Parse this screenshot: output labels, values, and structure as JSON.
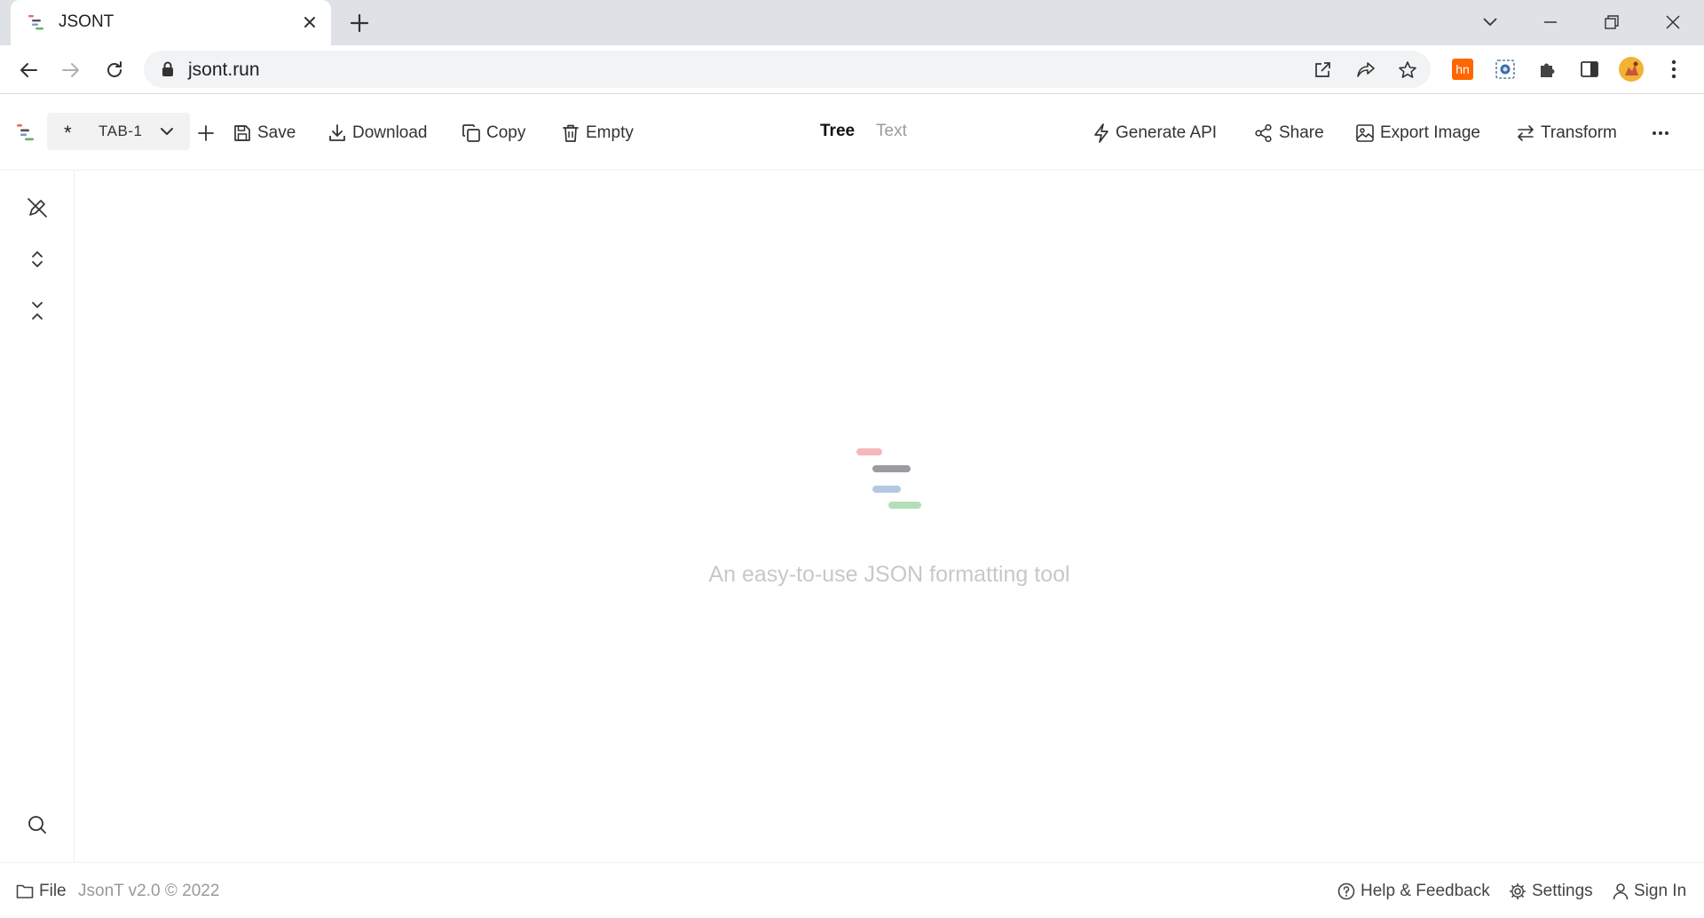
{
  "browser": {
    "tab_title": "JSONT",
    "url": "jsont.run",
    "extensions": [
      "hn-extension-icon",
      "screenshot-extension-icon",
      "puzzle-icon",
      "sidepanel-icon",
      "profile-avatar"
    ]
  },
  "header": {
    "tab_selector": {
      "marker": "*",
      "label": "TAB-1"
    },
    "actions": {
      "save": "Save",
      "download": "Download",
      "copy": "Copy",
      "empty": "Empty"
    },
    "modes": {
      "tree": "Tree",
      "text": "Text",
      "active": "Tree"
    },
    "right_actions": {
      "generate_api": "Generate API",
      "share": "Share",
      "export_image": "Export Image",
      "transform": "Transform"
    }
  },
  "empty_state": {
    "tagline": "An easy-to-use JSON formatting tool",
    "logo_colors": [
      "#f4b8bb",
      "#9a9ca0",
      "#b5c8e3",
      "#b3dfb8"
    ]
  },
  "footer": {
    "file": "File",
    "version": "JsonT v2.0 © 2022",
    "help": "Help & Feedback",
    "settings": "Settings",
    "sign_in": "Sign In"
  },
  "colors": {
    "tabstrip": "#dee1e6",
    "omnibox": "#f1f3f4",
    "hn_extension": "#ff6600"
  }
}
